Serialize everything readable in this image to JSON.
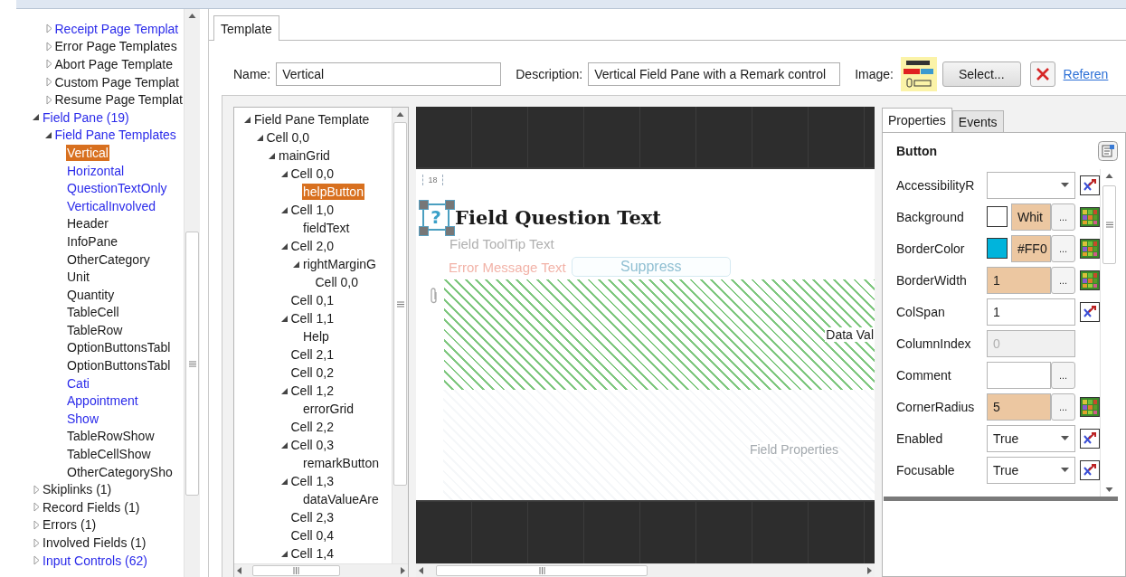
{
  "nav_tree": {
    "continued_items": [
      {
        "label": "Receipt Page Templat",
        "kind": "branch",
        "expanded": false,
        "selected": false,
        "color": "#2b2bea"
      },
      {
        "label": "Error Page Templates",
        "kind": "branch",
        "expanded": false,
        "selected": false,
        "color": "#1a1a1a"
      },
      {
        "label": "Abort Page Template",
        "kind": "branch",
        "expanded": false,
        "selected": false,
        "color": "#1a1a1a"
      },
      {
        "label": "Custom Page Templat",
        "kind": "branch",
        "expanded": false,
        "selected": false,
        "color": "#1a1a1a"
      },
      {
        "label": "Resume Page Templat",
        "kind": "branch",
        "expanded": false,
        "selected": false,
        "color": "#1a1a1a"
      }
    ],
    "items": [
      {
        "label": "Field Pane (19)",
        "kind": "branch",
        "expanded": true,
        "selected": false,
        "color": "#2b2bea",
        "children": [
          {
            "label": "Field Pane Templates",
            "kind": "branch",
            "expanded": true,
            "selected": false,
            "color": "#2b2bea",
            "children": [
              {
                "label": "Vertical",
                "kind": "leaf",
                "selected": true
              },
              {
                "label": "Horizontal",
                "kind": "leaf",
                "selected": false,
                "color": "#2b2bea"
              },
              {
                "label": "QuestionTextOnly",
                "kind": "leaf",
                "selected": false,
                "color": "#2b2bea"
              },
              {
                "label": "VerticalInvolved",
                "kind": "leaf",
                "selected": false,
                "color": "#2b2bea"
              },
              {
                "label": "Header",
                "kind": "leaf",
                "selected": false,
                "color": "#1a1a1a"
              },
              {
                "label": "InfoPane",
                "kind": "leaf",
                "selected": false,
                "color": "#1a1a1a"
              },
              {
                "label": "OtherCategory",
                "kind": "leaf",
                "selected": false,
                "color": "#1a1a1a"
              },
              {
                "label": "Unit",
                "kind": "leaf",
                "selected": false,
                "color": "#1a1a1a"
              },
              {
                "label": "Quantity",
                "kind": "leaf",
                "selected": false,
                "color": "#1a1a1a"
              },
              {
                "label": "TableCell",
                "kind": "leaf",
                "selected": false,
                "color": "#1a1a1a"
              },
              {
                "label": "TableRow",
                "kind": "leaf",
                "selected": false,
                "color": "#1a1a1a"
              },
              {
                "label": "OptionButtonsTabl",
                "kind": "leaf",
                "selected": false,
                "color": "#1a1a1a"
              },
              {
                "label": "OptionButtonsTabl",
                "kind": "leaf",
                "selected": false,
                "color": "#1a1a1a"
              },
              {
                "label": "Cati",
                "kind": "leaf",
                "selected": false,
                "color": "#2b2bea"
              },
              {
                "label": "Appointment",
                "kind": "leaf",
                "selected": false,
                "color": "#2b2bea"
              },
              {
                "label": "Show",
                "kind": "leaf",
                "selected": false,
                "color": "#2b2bea"
              },
              {
                "label": "TableRowShow",
                "kind": "leaf",
                "selected": false,
                "color": "#1a1a1a"
              },
              {
                "label": "TableCellShow",
                "kind": "leaf",
                "selected": false,
                "color": "#1a1a1a"
              },
              {
                "label": "OtherCategorySho",
                "kind": "leaf",
                "selected": false,
                "color": "#1a1a1a"
              }
            ]
          }
        ]
      },
      {
        "label": "Skiplinks (1)",
        "kind": "branch",
        "expanded": false,
        "selected": false,
        "color": "#1a1a1a"
      },
      {
        "label": "Record Fields (1)",
        "kind": "branch",
        "expanded": false,
        "selected": false,
        "color": "#1a1a1a"
      },
      {
        "label": "Errors (1)",
        "kind": "branch",
        "expanded": false,
        "selected": false,
        "color": "#1a1a1a"
      },
      {
        "label": "Involved Fields (1)",
        "kind": "branch",
        "expanded": false,
        "selected": false,
        "color": "#1a1a1a"
      },
      {
        "label": "Input Controls (62)",
        "kind": "branch",
        "expanded": false,
        "selected": false,
        "color": "#2b2bea"
      }
    ]
  },
  "tabs": [
    {
      "label": "Template",
      "selected": true
    }
  ],
  "form": {
    "name_label": "Name:",
    "name_value": "Vertical",
    "description_label": "Description:",
    "description_value": "Vertical Field Pane with a Remark control",
    "image_label": "Image:",
    "select_button": "Select...",
    "link": "Referen"
  },
  "template_tree": [
    {
      "label": "Field Pane Template",
      "kind": "branch",
      "expanded": true,
      "selected": false,
      "children": [
        {
          "label": "Cell 0,0",
          "kind": "branch",
          "expanded": true,
          "selected": false,
          "children": [
            {
              "label": "mainGrid",
              "kind": "branch",
              "expanded": true,
              "selected": false,
              "children": [
                {
                  "label": "Cell 0,0",
                  "kind": "branch",
                  "expanded": true,
                  "selected": false,
                  "children": [
                    {
                      "label": "helpButton",
                      "kind": "leaf",
                      "selected": true
                    }
                  ]
                },
                {
                  "label": "Cell 1,0",
                  "kind": "branch",
                  "expanded": true,
                  "selected": false,
                  "children": [
                    {
                      "label": "fieldText",
                      "kind": "leaf",
                      "selected": false
                    }
                  ]
                },
                {
                  "label": "Cell 2,0",
                  "kind": "branch",
                  "expanded": true,
                  "selected": false,
                  "children": [
                    {
                      "label": "rightMarginG",
                      "kind": "branch",
                      "expanded": true,
                      "selected": false,
                      "children": [
                        {
                          "label": "Cell 0,0",
                          "kind": "leaf",
                          "selected": false
                        }
                      ]
                    }
                  ]
                },
                {
                  "label": "Cell 0,1",
                  "kind": "leaf",
                  "selected": false
                },
                {
                  "label": "Cell 1,1",
                  "kind": "branch",
                  "expanded": true,
                  "selected": false,
                  "children": [
                    {
                      "label": "Help",
                      "kind": "leaf",
                      "selected": false
                    }
                  ]
                },
                {
                  "label": "Cell 2,1",
                  "kind": "leaf",
                  "selected": false
                },
                {
                  "label": "Cell 0,2",
                  "kind": "leaf",
                  "selected": false
                },
                {
                  "label": "Cell 1,2",
                  "kind": "branch",
                  "expanded": true,
                  "selected": false,
                  "children": [
                    {
                      "label": "errorGrid",
                      "kind": "leaf",
                      "selected": false
                    }
                  ]
                },
                {
                  "label": "Cell 2,2",
                  "kind": "leaf",
                  "selected": false
                },
                {
                  "label": "Cell 0,3",
                  "kind": "branch",
                  "expanded": true,
                  "selected": false,
                  "children": [
                    {
                      "label": "remarkButton",
                      "kind": "leaf",
                      "selected": false
                    }
                  ]
                },
                {
                  "label": "Cell 1,3",
                  "kind": "branch",
                  "expanded": true,
                  "selected": false,
                  "children": [
                    {
                      "label": "dataValueAre",
                      "kind": "leaf",
                      "selected": false
                    }
                  ]
                },
                {
                  "label": "Cell 2,3",
                  "kind": "leaf",
                  "selected": false
                },
                {
                  "label": "Cell 0,4",
                  "kind": "leaf",
                  "selected": false
                },
                {
                  "label": "Cell 1,4",
                  "kind": "branch",
                  "expanded": true,
                  "selected": false
                }
              ]
            }
          ]
        }
      ]
    }
  ],
  "canvas": {
    "dimension": "18",
    "help_button": "?",
    "question": "Field Question Text",
    "tooltip": "Field ToolTip Text",
    "error": "Error Message Text",
    "suppress": "Suppress",
    "data_value": "Data Val",
    "field_properties": "Field Properties"
  },
  "properties": {
    "tabs": [
      {
        "label": "Properties",
        "selected": true
      },
      {
        "label": "Events",
        "selected": false
      }
    ],
    "title": "Button",
    "rows": [
      {
        "label": "AccessibilityR",
        "kind": "combo",
        "value": "",
        "overridden": false,
        "action": {
          "kind": "reset"
        }
      },
      {
        "label": "Background",
        "kind": "color",
        "color": "#ffffff",
        "value": "Whit",
        "overridden": true,
        "button": "...",
        "action": {
          "kind": "palette"
        }
      },
      {
        "label": "BorderColor",
        "kind": "color",
        "color": "#00b4dc",
        "value": "#FF0",
        "overridden": true,
        "button": "...",
        "action": {
          "kind": "palette"
        }
      },
      {
        "label": "BorderWidth",
        "kind": "dialog",
        "value": "1",
        "overridden": true,
        "button": "...",
        "action": {
          "kind": "palette"
        }
      },
      {
        "label": "ColSpan",
        "kind": "text",
        "value": "1",
        "overridden": false,
        "action": {
          "kind": "reset"
        }
      },
      {
        "label": "ColumnIndex",
        "kind": "readonly",
        "value": "0"
      },
      {
        "label": "Comment",
        "kind": "dialog",
        "value": "",
        "overridden": false,
        "button": "..."
      },
      {
        "label": "CornerRadius",
        "kind": "dialog",
        "value": "5",
        "overridden": true,
        "button": "...",
        "action": {
          "kind": "palette"
        }
      },
      {
        "label": "Enabled",
        "kind": "combo",
        "value": "True",
        "overridden": false,
        "action": {
          "kind": "reset"
        }
      },
      {
        "label": "Focusable",
        "kind": "combo",
        "value": "True",
        "overridden": false,
        "action": {
          "kind": "reset"
        }
      }
    ]
  }
}
